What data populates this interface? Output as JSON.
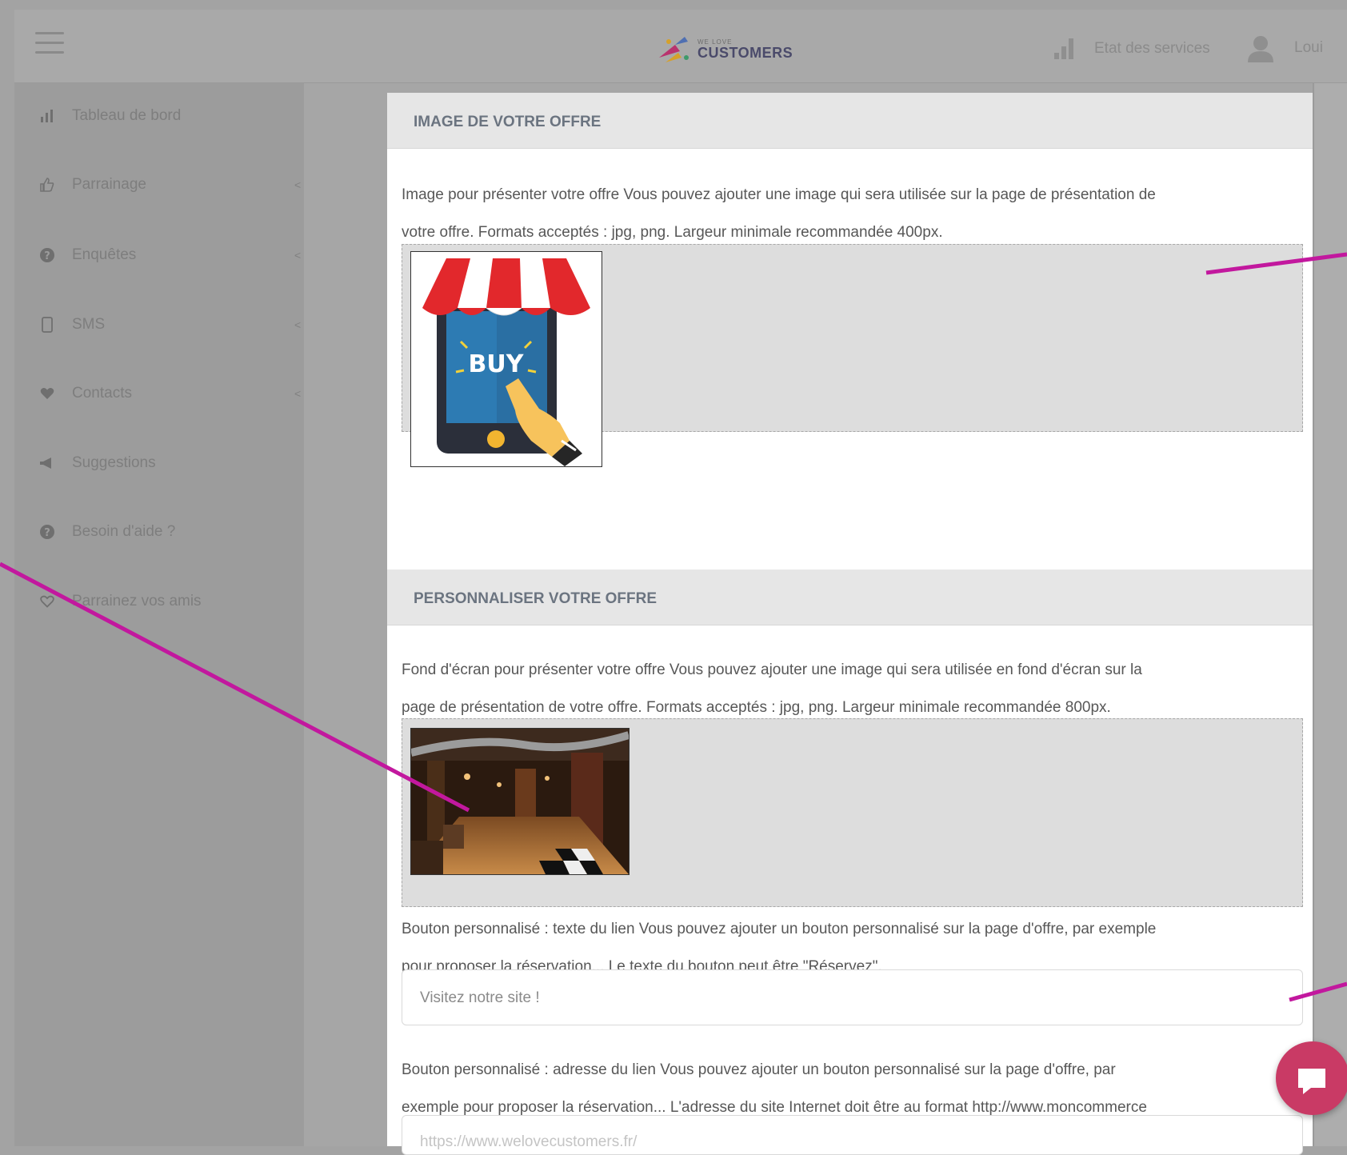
{
  "header": {
    "brand_small": "WE LOVE",
    "brand_big": "CUSTOMERS",
    "status_label": "Etat des services",
    "user_label": "Loui"
  },
  "sidebar": {
    "items": [
      {
        "label": "Tableau de bord",
        "icon": "bar-chart-icon"
      },
      {
        "label": "Parrainage",
        "icon": "thumbs-up-icon",
        "chevron": "<"
      },
      {
        "label": "Enquêtes",
        "icon": "question-circle-icon",
        "chevron": "<"
      },
      {
        "label": "SMS",
        "icon": "mobile-icon",
        "chevron": "<"
      },
      {
        "label": "Contacts",
        "icon": "heart-icon",
        "chevron": "<"
      },
      {
        "label": "Suggestions",
        "icon": "megaphone-icon"
      },
      {
        "label": "Besoin d'aide ?",
        "icon": "help-circle-icon"
      },
      {
        "label": "Parrainez vos amis",
        "icon": "heart-outline-icon"
      }
    ]
  },
  "sections": {
    "image": {
      "title": "IMAGE DE VOTRE OFFRE",
      "desc_line1": "Image pour présenter votre offre Vous pouvez ajouter une image qui sera utilisée sur la page de présentation de",
      "desc_line2": "votre offre. Formats acceptés : jpg, png. Largeur minimale recommandée 400px.",
      "thumb_text": "BUY"
    },
    "custom": {
      "title": "PERSONNALISER VOTRE OFFRE",
      "bg_desc_line1": "Fond d'écran pour présenter votre offre Vous pouvez ajouter une image qui sera utilisée en fond d'écran sur la",
      "bg_desc_line2": "page de présentation de votre offre. Formats acceptés : jpg, png. Largeur minimale recommandée 800px.",
      "btn_text_desc_line1": "Bouton personnalisé : texte du lien Vous pouvez ajouter un bouton personnalisé sur la page d'offre, par exemple",
      "btn_text_desc_line2": "pour proposer la réservation... Le texte du bouton peut être \"Réservez\".",
      "btn_text_value": "Visitez notre site !",
      "btn_link_desc_line1": "Bouton personnalisé : adresse du lien Vous pouvez ajouter un bouton personnalisé sur la page d'offre, par",
      "btn_link_desc_line2": "exemple pour proposer la réservation... L'adresse du site Internet doit être au format http://www.moncommerce",
      "btn_link_value": "https://www.welovecustomers.fr/"
    }
  },
  "colors": {
    "annotation": "#c2189e",
    "chat": "#c93a65"
  }
}
